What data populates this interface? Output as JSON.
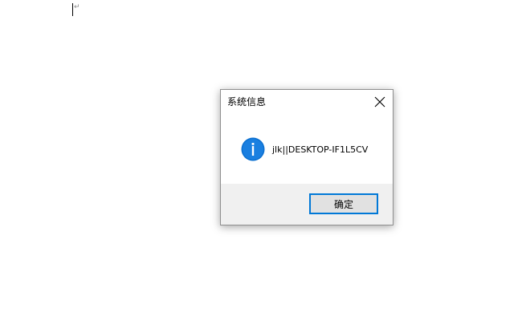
{
  "document": {
    "paragraph_mark": "↵"
  },
  "dialog": {
    "title": "系统信息",
    "icon": "info-icon",
    "message": "jlk||DESKTOP-IF1L5CV",
    "ok_label": "确定",
    "accent_color": "#0078d7",
    "icon_color": "#0a6fd0"
  }
}
